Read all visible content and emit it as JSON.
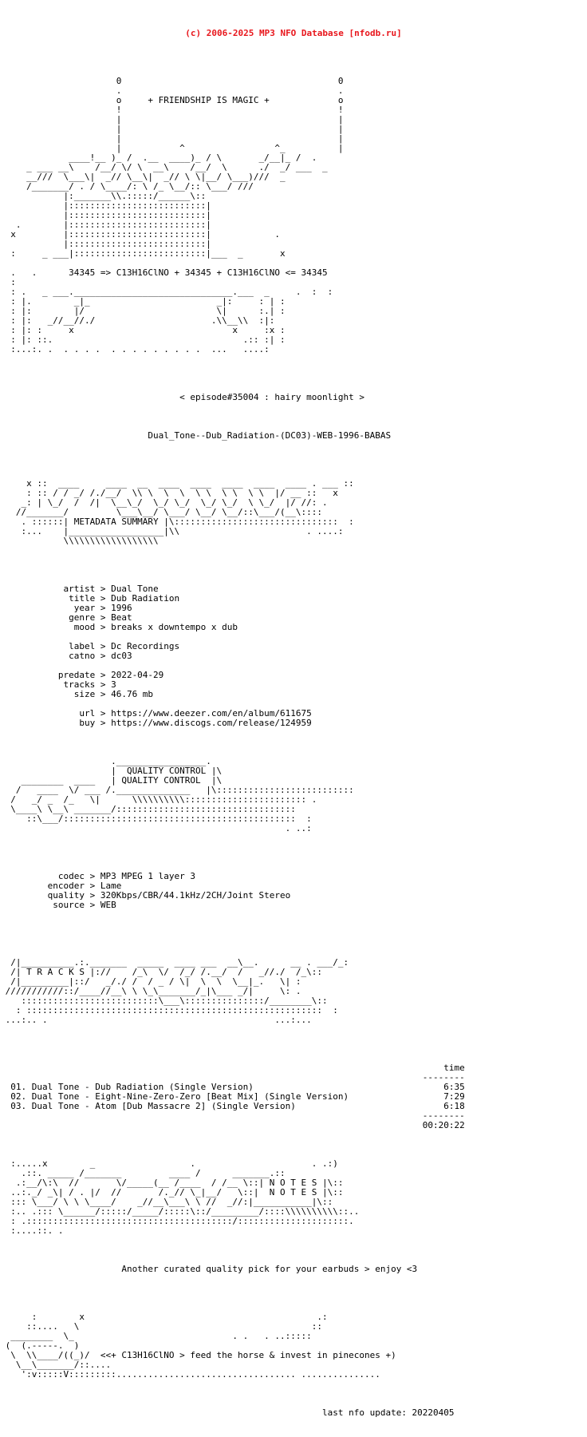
{
  "page": {
    "background_color": "#ffffff",
    "text_color": "#000000",
    "accent_color": "#e8161c"
  },
  "header": {
    "copyright_line": "(c) 2006-2025 MP3 NFO Database [nfodb.ru]"
  },
  "banner": {
    "tagline": "+ FRIENDSHIP IS MAGIC +",
    "formula_line": "34345 => C13H16ClNO + 34345 + C13H16ClNO <= 34345",
    "episode_line": "< episode#35004 : hairy moonlight >",
    "release_name": "Dual_Tone--Dub_Radiation-(DC03)-WEB-1996-BABAS",
    "top_art": [
      "                      0                                         0",
      "                      .                                         .",
      "                      o     + FRIENDSHIP IS MAGIC +             o",
      "                      !                                         !",
      "                      |                                         |",
      "                      |                                         |",
      "                      |                                         |",
      "                      |           ^                 ^_          |",
      "             ____!__ )_ /  .__  ____)_ / \\       _/__|_ /  .",
      "     _ ___ __\\    /__/ \\/ \\  __\\    /__/  \\      ./  _/ ___  _",
      "     __///  \\___\\|  _// \\__\\|  _// \\ \\|__/ \\___)///  _",
      "     /_______/ . / \\____/: \\ /_ \\__/:: \\___/ ///",
      "            |:_______\\\\.:::::/______\\::",
      "            |::::::::::::::::::::::::::|",
      "            |::::::::::::::::::::::::::|",
      "   .        |::::::::::::::::::::::::::|",
      "  x         |::::::::::::::::::::::::::|            .",
      "            |::::::::::::::::::::::::::|",
      "  :     _ ___|:::::::::::::::::::::::::|___  _       x",
      "",
      "  .   .      34345 => C13H16ClNO + 34345 + C13H16ClNO <= 34345",
      "  :",
      "  : .   _ ___.______________________________.___  _     .  :  :",
      "  : |.        _|_                        _|:     : | :",
      "  : |:        |/                         \\|      :.| :",
      "  : |:   _//__//./                      .\\\\__\\\\  :|:",
      "  : |: :     x                              x     :x :",
      "  : |: ::.                                    .:: :| :",
      "  :...:. .  . . . .  . . . . . . . . .  ...   ....:"
    ]
  },
  "sections": {
    "metadata": {
      "title": "METADATA SUMMARY",
      "art": [
        "     x ::  ____     ____  __  ____  ____  ____  ____  ____ . ___ ::",
        "     : :: / / _/ /./__/  \\\\ \\  \\  \\  \\ \\  \\ \\  \\ \\  |/ __ ::   x",
        "    _: | \\_/  /  /|  \\__\\_/  \\_/ \\_/  \\_/ \\_/  \\ \\_/  |/ //: .",
        "   //_______/         \\___\\__/ \\___/ \\__/ \\__/::\\___/(__\\::::",
        "    . ::::::| METADATA SUMMARY |\\:::::::::::::::::::::::::::::::  :",
        "    :...    |__________________|\\\\                        . ....:",
        "            \\\\\\\\\\\\\\\\\\\\\\\\\\\\\\\\\\\\"
      ],
      "fields": [
        {
          "label": "artist",
          "value": "Dual Tone"
        },
        {
          "label": "title",
          "value": "Dub Radiation"
        },
        {
          "label": "year",
          "value": "1996"
        },
        {
          "label": "genre",
          "value": "Beat"
        },
        {
          "label": "mood",
          "value": "breaks x downtempo x dub"
        },
        {
          "label": "label",
          "value": "Dc Recordings"
        },
        {
          "label": "catno",
          "value": "dc03"
        },
        {
          "label": "predate",
          "value": "2022-04-29"
        },
        {
          "label": "tracks",
          "value": "3"
        },
        {
          "label": "size",
          "value": "46.76 mb"
        },
        {
          "label": "url",
          "value": "https://www.deezer.com/en/album/611675"
        },
        {
          "label": "buy",
          "value": "https://www.discogs.com/release/124959"
        }
      ],
      "block": [
        "      artist > Dual Tone",
        "       title > Dub Radiation",
        "        year > 1996",
        "       genre > Beat",
        "        mood > breaks x downtempo x dub",
        "",
        "       label > Dc Recordings",
        "       catno > dc03",
        "",
        "     predate > 2022-04-29",
        "      tracks > 3",
        "        size > 46.76 mb",
        "",
        "         url > https://www.deezer.com/en/album/611675",
        "         buy > https://www.discogs.com/release/124959"
      ]
    },
    "quality": {
      "title": "QUALITY CONTROL",
      "art": [
        "                     ._________________.",
        "                     |  QUALITY CONTROL |\\",
        "    ________  ____   | QUALITY CONTROL  |\\",
        "   /   ____  \\/ ___ /.______________   |\\::::::::::::::::::::::::::",
        "  /   _/ _  /_   \\|      \\\\\\\\\\\\\\\\\\\\::::::::::::::::::::::: .",
        "  \\____\\ \\__\\ _______/::::::::::::::::::::::::::::::::::",
        "     ::\\___/::::::::::::::::::::::::::::::::::::::::::::  :",
        "                                                      . ..:"
      ],
      "fields": [
        {
          "label": "codec",
          "value": "MP3 MPEG 1 layer 3"
        },
        {
          "label": "encoder",
          "value": "Lame"
        },
        {
          "label": "quality",
          "value": "320Kbps/CBR/44.1kHz/2CH/Joint Stereo"
        },
        {
          "label": "source",
          "value": "WEB"
        }
      ],
      "block": [
        "       codec > MP3 MPEG 1 layer 3",
        "     encoder > Lame",
        "     quality > 320Kbps/CBR/44.1kHz/2CH/Joint Stereo",
        "      source > WEB"
      ]
    },
    "tracks": {
      "title": "T R A C K S",
      "art": [
        "  /|__________.:._______  _____  ____ ___  __\\__.      __ . ___/_:",
        "  /| T R A C K S |://    /_\\  \\/  /_/ /.__/  /   _//./  /_\\::",
        "  /|_________|::/   _/./ /  / _ / \\|  \\  \\  \\__|_.   \\| :",
        " ///////////::/____//__\\ \\ \\_\\_______/_|\\___ _/|     \\: .",
        "    ::::::::::::::::::::::::::\\___\\:::::::::::::::/________\\::",
        "   : ::::::::::::::::::::::::::::::::::::::::::::::::::::::::  :",
        " ...:.. .                                           ...:..."
      ],
      "time_header": "time",
      "divider": "--------",
      "items": [
        {
          "num": "01.",
          "title": "Dual Tone - Dub Radiation (Single Version)",
          "time": "6:35"
        },
        {
          "num": "02.",
          "title": "Dual Tone - Eight-Nine-Zero-Zero [Beat Mix] (Single Version)",
          "time": "7:29"
        },
        {
          "num": "03.",
          "title": "Dual Tone - Atom [Dub Massacre 2] (Single Version)",
          "time": "6:18"
        }
      ],
      "total_time": "00:20:22",
      "block": [
        "                                                             time",
        "                                                         --------",
        "  01. Dual Tone - Dub Radiation (Single Version)              6:35",
        "  02. Dual Tone - Eight-Nine-Zero-Zero [Beat Mix] (Single Version)   7:29",
        "  03. Dual Tone - Atom [Dub Massacre 2] (Single Version)      6:18",
        "                                                         --------",
        "                                                         00:20:22"
      ]
    },
    "notes": {
      "title": "N O T E S",
      "art": [
        "  :.....x        _                  .                      . .:)",
        "    .::. _____ /_______         ____ /      _______.::",
        "   .:__/\\:\\  //       \\/_____(__ /____  / /__ \\::| N O T E S |\\::",
        "  ..:._/ _\\| / . |/  //       /._// \\_|__/   \\::|  N O T E S |\\::",
        "  ::: \\___/ \\ \\ \\____/    _//__\\___\\ \\ //  _//:|___________|\\::",
        "  :.. .::: \\______/:::::/_____/:::::\\::/_________/::::\\\\\\\\\\\\\\\\\\\\::..",
        "  : .:::::::::::::::::::::::::::::::::::::::/:::::::::::::::::::::.",
        "  :....::. ."
      ],
      "message": "Another curated quality pick for your earbuds > enjoy <3"
    }
  },
  "footer": {
    "art": [
      "      :        x                                            .:",
      "     ::....   \\                                            ::",
      "  ________  \\_                              . .   . ..:::::",
      " (  (.-----.  )",
      "  \\  \\\\____/((_)/  <<+ C13H16ClNO > feed the horse & invest in pinecones +)",
      "   \\__\\_______/::....",
      "    ':v:::::V:::::::::.................................. ..............."
    ],
    "signature_line": "<<+ C13H16ClNO > feed the horse & invest in pinecones +)",
    "last_update_label": "last nfo update:",
    "last_update_value": "20220405",
    "last_update_line": "                             last nfo update: 20220405"
  }
}
